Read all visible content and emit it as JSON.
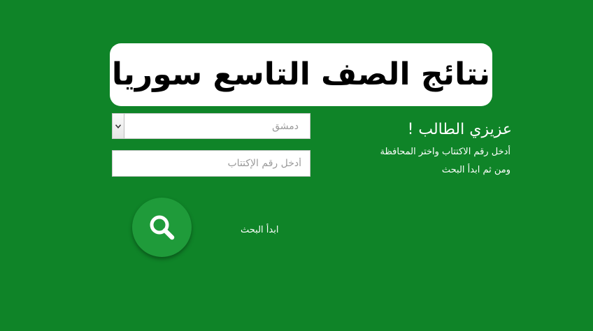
{
  "banner": {
    "title": "نتائج الصف التاسع سوريا"
  },
  "governorate_select": {
    "selected": "دمشق",
    "arrow_icon": "chevron-down-icon"
  },
  "exam_number_input": {
    "value": "",
    "placeholder": "أدخل رقم الإكتتاب"
  },
  "instructions": {
    "title": "عزيزي الطالب !",
    "line1": "أدخل رقم الاكتتاب واختر المحافظة",
    "line2": "ومن ثم ابدأ البحث"
  },
  "search": {
    "icon": "search-icon",
    "label": "ابدأ البحث"
  },
  "colors": {
    "background": "#0f8428",
    "search_button": "#1f9b3a",
    "banner_bg": "#ffffff",
    "banner_text": "#000000"
  }
}
